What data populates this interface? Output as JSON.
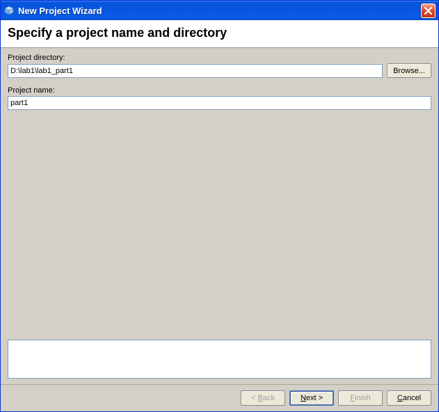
{
  "window": {
    "title": "New Project Wizard"
  },
  "header": {
    "title": "Specify a project name and directory"
  },
  "form": {
    "directory_label": "Project directory:",
    "directory_value": "D:\\lab1\\lab1_part1",
    "browse_label": "Browse...",
    "name_label": "Project name:",
    "name_value": "part1"
  },
  "buttons": {
    "back_prefix": "< ",
    "back_m": "B",
    "back_rest": "ack",
    "next_m": "N",
    "next_rest": "ext >",
    "finish_pre": "",
    "finish_m": "F",
    "finish_rest": "inish",
    "cancel_m": "C",
    "cancel_rest": "ancel"
  }
}
